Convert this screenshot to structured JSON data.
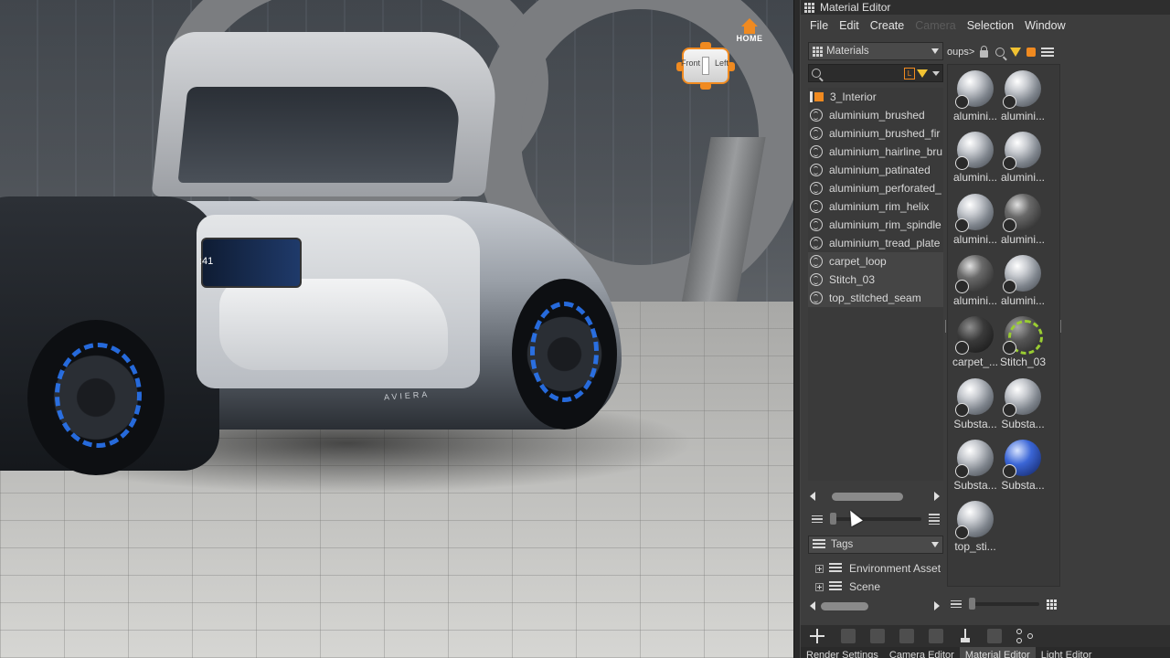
{
  "viewport": {
    "home_label": "HOME",
    "navcube": {
      "front_label": "Front",
      "left_label": "Left"
    },
    "dashboard_time": ":41",
    "car_brand": "AVIERA"
  },
  "editor": {
    "window_title": "Material Editor",
    "menu": [
      {
        "label": "File",
        "enabled": true
      },
      {
        "label": "Edit",
        "enabled": true
      },
      {
        "label": "Create",
        "enabled": true
      },
      {
        "label": "Camera",
        "enabled": false
      },
      {
        "label": "Selection",
        "enabled": true
      },
      {
        "label": "Window",
        "enabled": true
      }
    ],
    "library_dropdown": "Materials",
    "search_value": "",
    "tree": {
      "group": "3_Interior",
      "items": [
        "aluminium_brushed",
        "aluminium_brushed_fir",
        "aluminium_hairline_bru",
        "aluminium_patinated",
        "aluminium_perforated_",
        "aluminium_rim_helix",
        "aluminium_rim_spindle",
        "aluminium_tread_plate",
        "carpet_loop",
        "Stitch_03",
        "top_stitched_seam"
      ]
    },
    "tags_dropdown": "Tags",
    "tags": [
      "Environment Asset",
      "Scene"
    ],
    "grid_path": "oups>",
    "grid_items": [
      {
        "name": "alumini...",
        "style": "metal"
      },
      {
        "name": "alumini...",
        "style": "metal"
      },
      {
        "name": "alumini...",
        "style": "metal"
      },
      {
        "name": "alumini...",
        "style": "metal"
      },
      {
        "name": "alumini...",
        "style": "metal"
      },
      {
        "name": "alumini...",
        "style": "textured"
      },
      {
        "name": "alumini...",
        "style": "textured"
      },
      {
        "name": "alumini...",
        "style": "metal"
      },
      {
        "name": "carpet_...",
        "style": "dark"
      },
      {
        "name": "Stitch_03",
        "style": "stitch"
      },
      {
        "name": "Substa...",
        "style": "metal"
      },
      {
        "name": "Substa...",
        "style": "metal"
      },
      {
        "name": "Substa...",
        "style": "metal"
      },
      {
        "name": "Substa...",
        "style": "blue"
      },
      {
        "name": "top_sti...",
        "style": "metal"
      }
    ],
    "tabs": [
      "Render Settings",
      "Camera Editor",
      "Material Editor",
      "Light Editor"
    ],
    "active_tab": "Material Editor"
  },
  "colors": {
    "accent": "#f08a20",
    "filter": "#f1c232",
    "panel_bg": "#3d3d3d"
  }
}
